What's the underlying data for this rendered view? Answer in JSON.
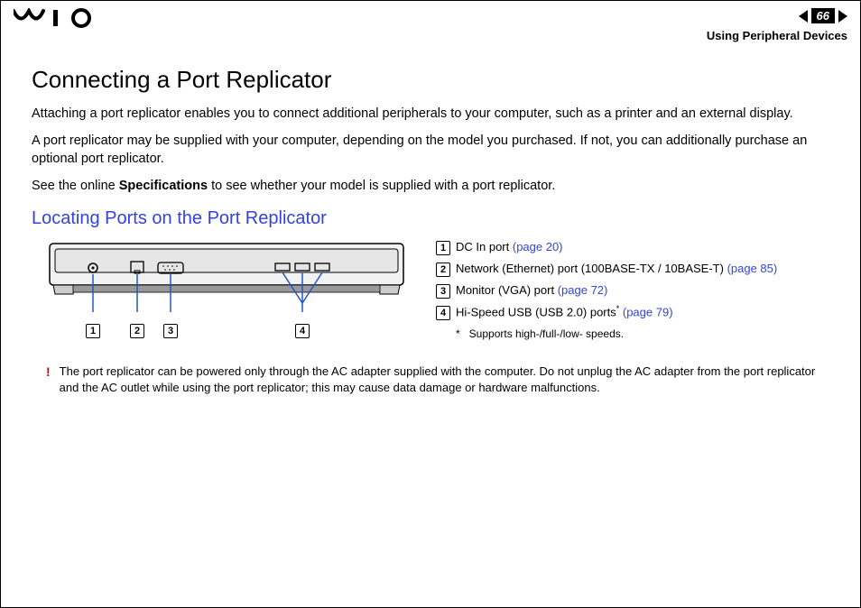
{
  "header": {
    "page_number": "66",
    "section": "Using Peripheral Devices"
  },
  "title": "Connecting a Port Replicator",
  "paragraphs": {
    "p1": "Attaching a port replicator enables you to connect additional peripherals to your computer, such as a printer and an external display.",
    "p2": "A port replicator may be supplied with your computer, depending on the model you purchased. If not, you can additionally purchase an optional port replicator.",
    "p3_a": "See the online ",
    "p3_b": "Specifications",
    "p3_c": " to see whether your model is supplied with a port replicator."
  },
  "subtitle": "Locating Ports on the Port Replicator",
  "callouts": {
    "n1": "1",
    "n2": "2",
    "n3": "3",
    "n4": "4"
  },
  "legend": {
    "item1": {
      "num": "1",
      "text": "DC In port ",
      "link": "(page 20)"
    },
    "item2": {
      "num": "2",
      "text": "Network (Ethernet) port (100BASE-TX / 10BASE-T) ",
      "link": "(page 85)"
    },
    "item3": {
      "num": "3",
      "text": "Monitor (VGA) port ",
      "link": "(page 72)"
    },
    "item4": {
      "num": "4",
      "text_a": "Hi-Speed USB (USB 2.0) ports",
      "star": "*",
      "spacer": " ",
      "link": "(page 79)"
    }
  },
  "footnote": {
    "star": "*",
    "text": "Supports high-/full-/low- speeds."
  },
  "warning": {
    "bang": "!",
    "text": "The port replicator can be powered only through the AC adapter supplied with the computer. Do not unplug the AC adapter from the port replicator and the AC outlet while using the port replicator; this may cause data damage or hardware malfunctions."
  }
}
